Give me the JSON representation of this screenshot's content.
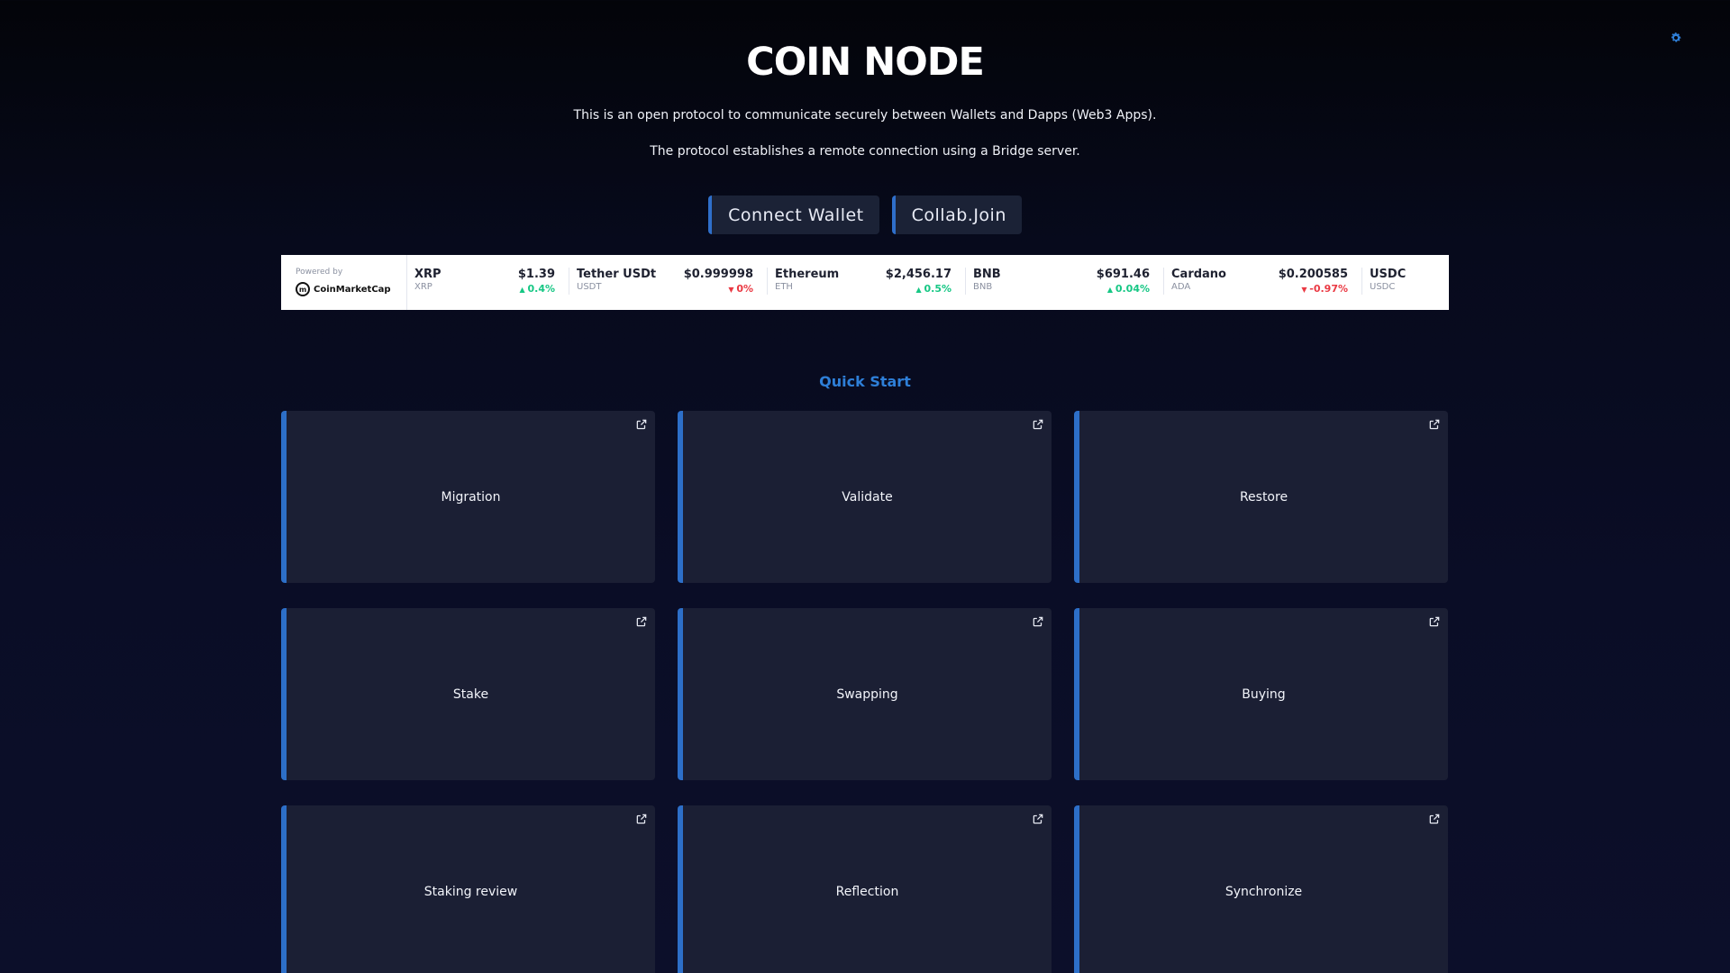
{
  "header": {
    "title": "COIN NODE",
    "desc1": "This is an open protocol to communicate securely between Wallets and Dapps (Web3 Apps).",
    "desc2": "The protocol establishes a remote connection using a Bridge server.",
    "settings_icon": "gear-icon"
  },
  "buttons": {
    "connect": "Connect Wallet",
    "collab": "Collab.Join"
  },
  "ticker": {
    "powered_by": "Powered by",
    "brand": "CoinMarketCap",
    "coins": [
      {
        "name": "XRP",
        "symbol": "XRP",
        "price": "$1.39",
        "change": "0.4%",
        "direction": "up"
      },
      {
        "name": "Tether USDt",
        "symbol": "USDT",
        "price": "$0.999998",
        "change": "0%",
        "direction": "down"
      },
      {
        "name": "Ethereum",
        "symbol": "ETH",
        "price": "$2,456.17",
        "change": "0.5%",
        "direction": "up"
      },
      {
        "name": "BNB",
        "symbol": "BNB",
        "price": "$691.46",
        "change": "0.04%",
        "direction": "up"
      },
      {
        "name": "Cardano",
        "symbol": "ADA",
        "price": "$0.200585",
        "change": "-0.97%",
        "direction": "down"
      },
      {
        "name": "USDC",
        "symbol": "USDC",
        "price": "",
        "change": "",
        "direction": "up"
      }
    ],
    "colors": {
      "up": "#16c784",
      "down": "#ea3943"
    }
  },
  "quick_start": {
    "heading": "Quick Start",
    "cards": [
      {
        "label": "Migration"
      },
      {
        "label": "Validate"
      },
      {
        "label": "Restore"
      },
      {
        "label": "Stake"
      },
      {
        "label": "Swapping"
      },
      {
        "label": "Buying"
      },
      {
        "label": "Staking review"
      },
      {
        "label": "Reflection"
      },
      {
        "label": "Synchronize"
      }
    ]
  },
  "colors": {
    "accent": "#2d6fc8",
    "card_bg": "#1b1f34",
    "background": "#0a0d26"
  }
}
